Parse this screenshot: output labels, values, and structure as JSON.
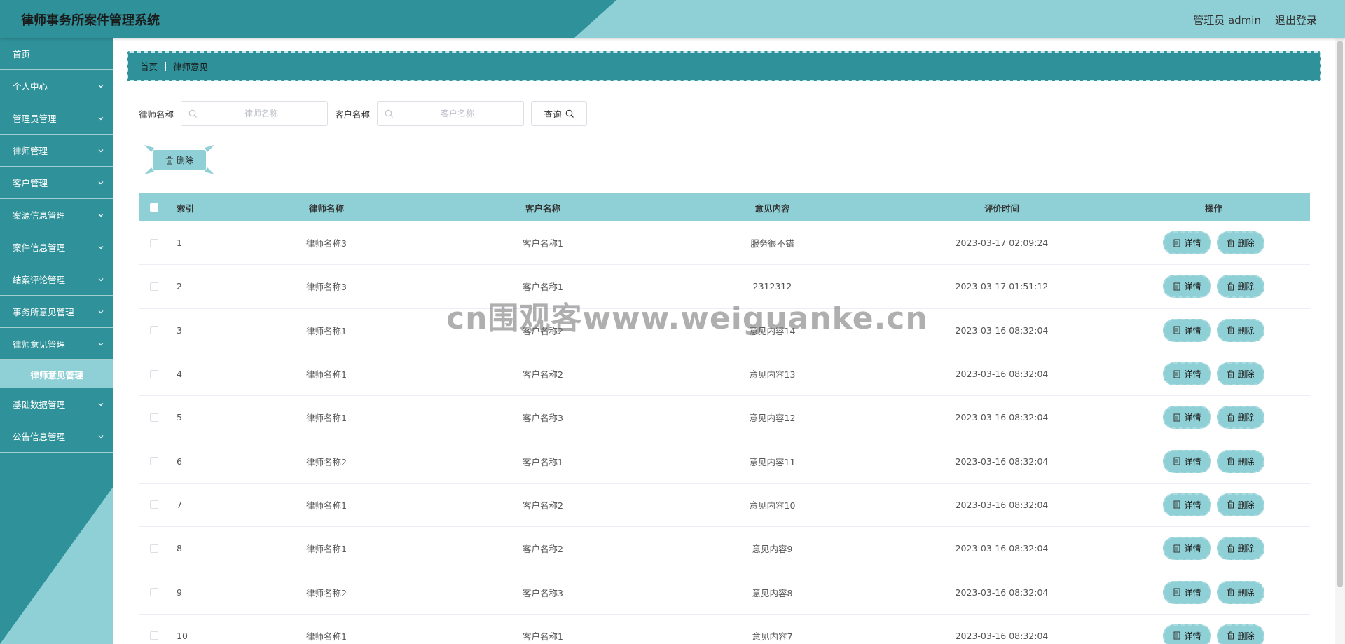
{
  "header": {
    "title": "律师事务所案件管理系统",
    "user": "管理员 admin",
    "logout": "退出登录"
  },
  "sidebar": {
    "items": [
      {
        "label": "首页",
        "expandable": false
      },
      {
        "label": "个人中心",
        "expandable": true
      },
      {
        "label": "管理员管理",
        "expandable": true
      },
      {
        "label": "律师管理",
        "expandable": true
      },
      {
        "label": "客户管理",
        "expandable": true
      },
      {
        "label": "案源信息管理",
        "expandable": true
      },
      {
        "label": "案件信息管理",
        "expandable": true
      },
      {
        "label": "结案评论管理",
        "expandable": true
      },
      {
        "label": "事务所意见管理",
        "expandable": true
      },
      {
        "label": "律师意见管理",
        "expandable": true
      },
      {
        "label": "基础数据管理",
        "expandable": true
      },
      {
        "label": "公告信息管理",
        "expandable": true
      }
    ],
    "active_sub": "律师意见管理"
  },
  "breadcrumb": {
    "home": "首页",
    "current": "律师意见"
  },
  "search": {
    "lawyer_label": "律师名称",
    "lawyer_placeholder": "律师名称",
    "client_label": "客户名称",
    "client_placeholder": "客户名称",
    "query_label": "查询"
  },
  "toolbar": {
    "delete_label": "删除"
  },
  "table": {
    "columns": [
      "索引",
      "律师名称",
      "客户名称",
      "意见内容",
      "评价时间",
      "操作"
    ],
    "rows": [
      [
        "1",
        "律师名称3",
        "客户名称1",
        "服务很不错",
        "2023-03-17 02:09:24"
      ],
      [
        "2",
        "律师名称3",
        "客户名称1",
        "2312312",
        "2023-03-17 01:51:12"
      ],
      [
        "3",
        "律师名称1",
        "客户名称2",
        "意见内容14",
        "2023-03-16 08:32:04"
      ],
      [
        "4",
        "律师名称1",
        "客户名称2",
        "意见内容13",
        "2023-03-16 08:32:04"
      ],
      [
        "5",
        "律师名称1",
        "客户名称3",
        "意见内容12",
        "2023-03-16 08:32:04"
      ],
      [
        "6",
        "律师名称2",
        "客户名称1",
        "意见内容11",
        "2023-03-16 08:32:04"
      ],
      [
        "7",
        "律师名称1",
        "客户名称2",
        "意见内容10",
        "2023-03-16 08:32:04"
      ],
      [
        "8",
        "律师名称1",
        "客户名称2",
        "意见内容9",
        "2023-03-16 08:32:04"
      ],
      [
        "9",
        "律师名称2",
        "客户名称3",
        "意见内容8",
        "2023-03-16 08:32:04"
      ],
      [
        "10",
        "律师名称1",
        "客户名称1",
        "意见内容7",
        "2023-03-16 08:32:04"
      ]
    ],
    "detail_label": "详情",
    "delete_label": "删除"
  },
  "watermark": "cn围观客www.weiguanke.cn",
  "colors": {
    "primary": "#2f9199",
    "light": "#8fd0d6"
  }
}
